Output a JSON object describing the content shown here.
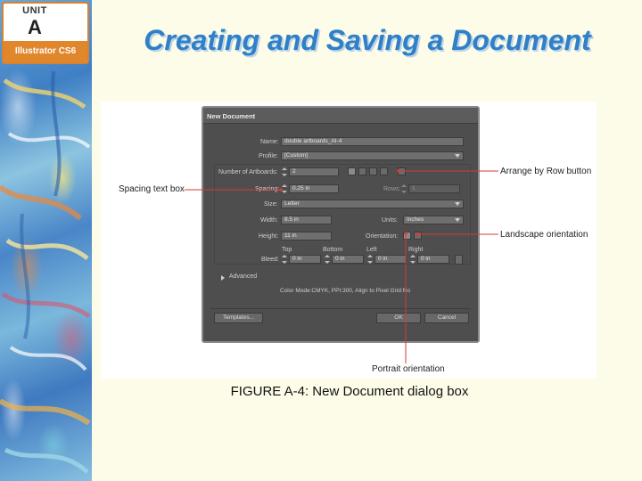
{
  "badge": {
    "unit_word": "UNIT",
    "unit_letter": "A",
    "product": "Illustrator CS6"
  },
  "slide": {
    "title": "Creating and Saving a Document"
  },
  "dialog": {
    "title": "New Document",
    "name_label": "Name:",
    "name_value": "double artboards_AI-4",
    "profile_label": "Profile:",
    "profile_value": "[Custom]",
    "artboards_label": "Number of Artboards:",
    "artboards_value": "2",
    "spacing_label": "Spacing:",
    "spacing_value": "0.25 in",
    "rows_label": "Rows:",
    "rows_value": "1",
    "size_label": "Size:",
    "size_value": "Letter",
    "width_label": "Width:",
    "width_value": "8.5 in",
    "units_label": "Units:",
    "units_value": "Inches",
    "height_label": "Height:",
    "height_value": "11 in",
    "orientation_label": "Orientation:",
    "bleed_label": "Bleed:",
    "top_label": "Top",
    "top_value": "0 in",
    "bottom_label": "Bottom",
    "bottom_value": "0 in",
    "left_label": "Left",
    "left_value": "0 in",
    "right_label": "Right",
    "right_value": "0 in",
    "advanced_label": "Advanced",
    "color_info": "Color Mode:CMYK, PPI:300, Align to Pixel Grid:No",
    "templates_button": "Templates...",
    "ok_button": "OK",
    "cancel_button": "Cancel"
  },
  "callouts": {
    "arrange_by_row": "Arrange by Row button",
    "spacing_text_box": "Spacing text box",
    "landscape_orientation": "Landscape orientation",
    "portrait_orientation": "Portrait orientation"
  },
  "caption": "FIGURE A-4: New Document dialog box",
  "colors": {
    "title_blue": "#2f80c6",
    "badge_orange": "#e0872c",
    "dialog_gray": "#4e4e4e",
    "callout_red": "#d63a3a"
  }
}
